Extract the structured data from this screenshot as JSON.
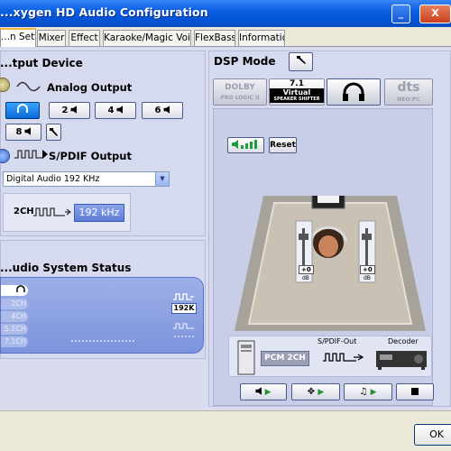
{
  "window": {
    "title": "...xygen HD Audio Configuration"
  },
  "tabs": [
    {
      "label": "...n Setting"
    },
    {
      "label": "Mixer"
    },
    {
      "label": "Effect"
    },
    {
      "label": "Karaoke/Magic Voice"
    },
    {
      "label": "FlexBass"
    },
    {
      "label": "Information"
    }
  ],
  "output": {
    "title": "...tput Device",
    "analog_label": "Analog Output",
    "channel_buttons": [
      {
        "label": "",
        "selected": true
      },
      {
        "label": "2"
      },
      {
        "label": "4"
      },
      {
        "label": "6"
      },
      {
        "label": "8"
      }
    ],
    "spdif_label": "S/PDIF Output",
    "spdif_rate": "Digital Audio 192 KHz",
    "rate_box": {
      "prefix": "2CH",
      "value": "192 kHz"
    }
  },
  "status": {
    "title": "...udio System Status",
    "channels": [
      "",
      "2CH",
      "4CH",
      "5.1CH",
      "7.1CH"
    ],
    "badge": "192K"
  },
  "dsp": {
    "title": "DSP Mode",
    "modes": [
      {
        "label": "DOLBY",
        "sub": "PRO LOGIC II"
      },
      {
        "label": "7.1",
        "sub": "Virtual",
        "sub2": "SPEAKER SHIFTER"
      },
      {
        "label": ""
      },
      {
        "label": "dts",
        "sub": "NEO:PC"
      }
    ],
    "reset_label": "Reset",
    "slider_left": "+0",
    "slider_right": "+0",
    "db_label": "dB",
    "chain": {
      "source": "PCM 2CH",
      "spdif_out": "S/PDIF-Out",
      "decoder": "Decoder"
    }
  },
  "footer": {
    "ok_label": "OK"
  },
  "colors": {
    "titlebar": "#0a5fe2",
    "panel": "#d6daee",
    "accent": "#0a6ad8"
  }
}
